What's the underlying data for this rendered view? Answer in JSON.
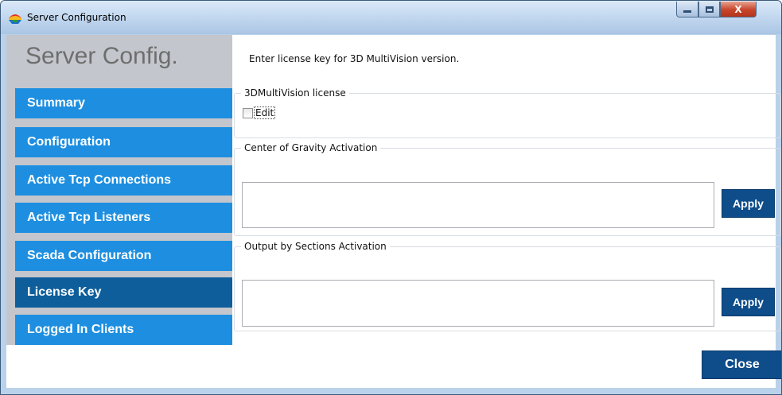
{
  "window": {
    "title": "Server Configuration",
    "minimize_glyph": "",
    "maximize_glyph": "",
    "close_glyph": "X"
  },
  "sidebar": {
    "header": "Server Config.",
    "items": [
      {
        "label": "Summary",
        "active": false
      },
      {
        "label": "Configuration",
        "active": false
      },
      {
        "label": "Active Tcp Connections",
        "active": false
      },
      {
        "label": "Active Tcp Listeners",
        "active": false
      },
      {
        "label": "Scada Configuration",
        "active": false
      },
      {
        "label": "License Key",
        "active": true
      },
      {
        "label": "Logged In Clients",
        "active": false
      }
    ]
  },
  "content": {
    "intro": "Enter license key for 3D MultiVision version.",
    "license_group": {
      "legend": "3DMultiVision license",
      "edit_label": "Edit",
      "edit_checked": false
    },
    "cog_group": {
      "legend": "Center of Gravity Activation",
      "input_value": "",
      "apply_label": "Apply"
    },
    "sections_group": {
      "legend": "Output by Sections Activation",
      "input_value": "",
      "apply_label": "Apply"
    },
    "close_label": "Close"
  },
  "colors": {
    "nav_item": "#1e8fe0",
    "nav_item_active": "#0e5e9c",
    "button": "#0e4d8a",
    "sidebar_bg": "#c3c6cc"
  },
  "icons": {
    "app": "app-logo-icon",
    "minimize": "minimize-icon",
    "maximize": "maximize-icon",
    "close": "close-icon"
  }
}
